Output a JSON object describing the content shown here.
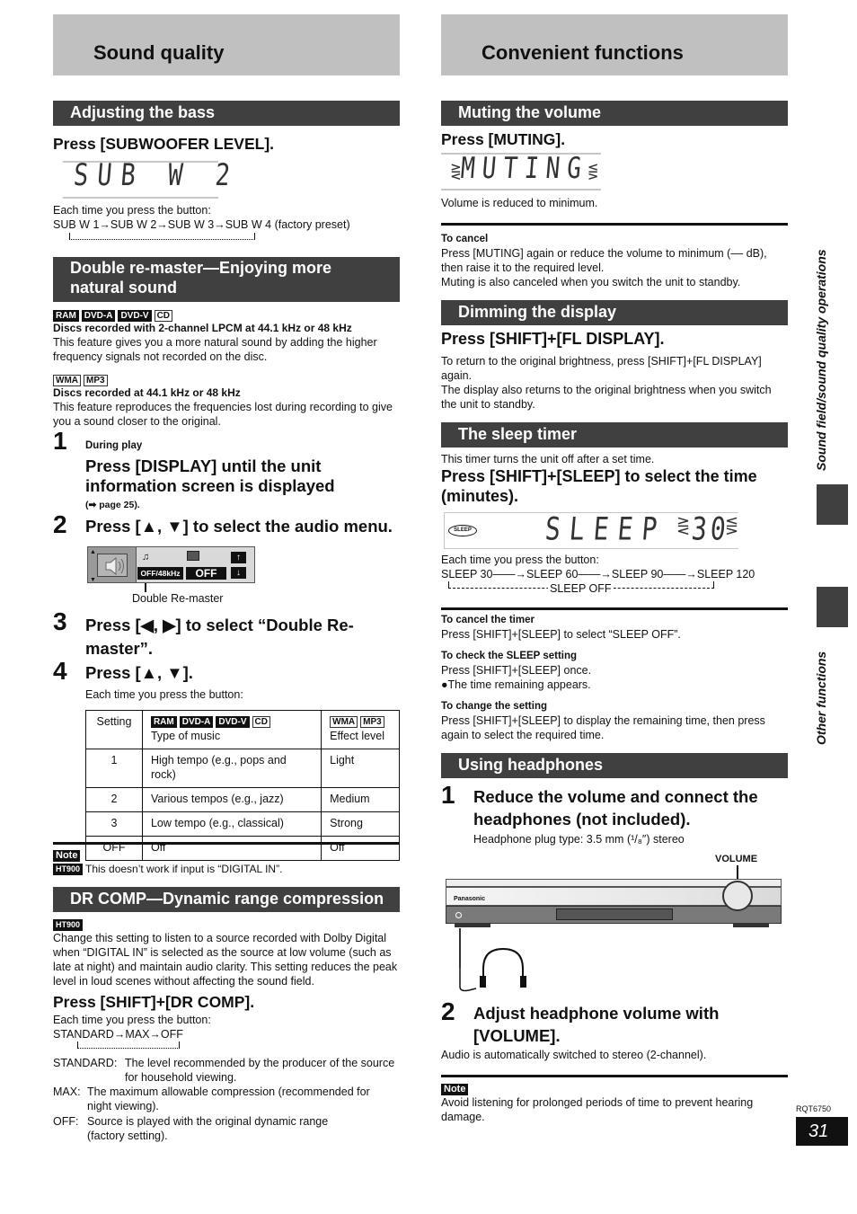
{
  "page": {
    "left_title": "Sound quality",
    "right_title": "Convenient functions",
    "side_labels": [
      "Sound field/sound quality operations",
      "Other functions"
    ],
    "model_code": "RQT6750",
    "page_number": "31"
  },
  "bass": {
    "section": "Adjusting the bass",
    "press": "Press [SUBWOOFER LEVEL].",
    "lcd": "SUB W 2",
    "each_time": "Each time you press the button:",
    "sequence": "SUB W 1→SUB W 2→SUB W 3→SUB W 4 (factory preset)"
  },
  "remaster": {
    "section_line1": "Double re-master—Enjoying more",
    "section_line2": "natural sound",
    "badges_a": [
      "RAM",
      "DVD-A",
      "DVD-V",
      "CD"
    ],
    "heading_a": "Discs recorded with 2-channel LPCM at 44.1 kHz or 48 kHz",
    "body_a": "This feature gives you a more natural sound by adding the higher frequency signals not recorded on the disc.",
    "badges_b": [
      "WMA",
      "MP3"
    ],
    "heading_b": "Discs recorded at 44.1 kHz or 48 kHz",
    "body_b": "This feature reproduces the frequencies lost during recording to give you a sound closer to the original.",
    "steps": [
      {
        "num": "1",
        "pre": "During play",
        "head": "Press [DISPLAY] until the unit information screen is displayed",
        "ref": "(➡ page 25)."
      },
      {
        "num": "2",
        "head": "Press [▲, ▼] to select the audio menu."
      },
      {
        "num": "3",
        "head": "Press [◀, ▶] to select “Double Re-master”."
      },
      {
        "num": "4",
        "head": "Press [▲, ▼].",
        "sub": "Each time you press the button:"
      }
    ],
    "osd": {
      "value1": "OFF/48kHz",
      "value2": "OFF",
      "caption": "Double Re-master"
    },
    "table": {
      "headers": [
        "Setting",
        "Type of music",
        "Effect level"
      ],
      "header_badges_mid": [
        "RAM",
        "DVD-A",
        "DVD-V",
        "CD"
      ],
      "header_badges_right": [
        "WMA",
        "MP3"
      ],
      "rows": [
        [
          "1",
          "High tempo (e.g., pops and rock)",
          "Light"
        ],
        [
          "2",
          "Various tempos (e.g., jazz)",
          "Medium"
        ],
        [
          "3",
          "Low tempo (e.g., classical)",
          "Strong"
        ],
        [
          "OFF",
          "Off",
          "Off"
        ]
      ]
    },
    "note_label": "Note",
    "note_badge": "HT900",
    "note_text": "This doesn’t work if input is “DIGITAL IN”."
  },
  "drcomp": {
    "section": "DR COMP—Dynamic range compression",
    "badge": "HT900",
    "body": "Change this setting to listen to a source recorded with Dolby Digital when “DIGITAL IN” is selected as the source at low volume (such as late at night) and maintain audio clarity. This setting reduces the peak level in loud scenes without affecting the sound field.",
    "press": "Press [SHIFT]+[DR COMP].",
    "each_time": "Each time you press the button:",
    "sequence": "STANDARD→MAX→OFF",
    "defs": [
      {
        "term": "STANDARD:",
        "desc1": "The level recommended by the producer of the source",
        "desc2": "for household viewing."
      },
      {
        "term": "MAX:",
        "desc1": "The maximum allowable compression (recommended for",
        "desc2": "night viewing)."
      },
      {
        "term": "OFF:",
        "desc1": "Source is played with the original dynamic range",
        "desc2": "(factory setting)."
      }
    ]
  },
  "muting": {
    "section": "Muting the volume",
    "press": "Press [MUTING].",
    "lcd": "MUTING",
    "body": "Volume is reduced to minimum.",
    "cancel_head": "To cancel",
    "cancel_1": "Press [MUTING] again or reduce the volume to minimum (–– dB),",
    "cancel_2": "then raise it to the required level.",
    "cancel_3": "Muting is also canceled when you switch the unit to standby."
  },
  "dimming": {
    "section": "Dimming the display",
    "press": "Press [SHIFT]+[FL DISPLAY].",
    "body_1": "To return to the original brightness, press [SHIFT]+[FL DISPLAY]",
    "body_2": "again.",
    "body_3": "The display also returns to the original brightness when you switch",
    "body_4": "the unit to standby."
  },
  "sleep": {
    "section": "The sleep timer",
    "intro": "This timer turns the unit off after a set time.",
    "press_1": "Press [SHIFT]+[SLEEP] to select the time",
    "press_2": "(minutes).",
    "lcd_tag": "SLEEP",
    "lcd": "SLEEP",
    "lcd_value": "30",
    "each_time": "Each time you press the button:",
    "sequence": "SLEEP 30——→SLEEP 60——→SLEEP 90——→SLEEP 120",
    "loop_label": "SLEEP OFF",
    "cancel_head": "To cancel the timer",
    "cancel_body": "Press [SHIFT]+[SLEEP] to select “SLEEP OFF”.",
    "check_head": "To check the SLEEP setting",
    "check_body": "Press [SHIFT]+[SLEEP] once.",
    "check_bullet": "●The time remaining appears.",
    "change_head": "To change the setting",
    "change_body_1": "Press [SHIFT]+[SLEEP] to display the remaining time, then press",
    "change_body_2": "again to select the required time."
  },
  "headphones": {
    "section": "Using headphones",
    "step1_num": "1",
    "step1_line1": "Reduce the volume and connect the",
    "step1_line2": "headphones (not included).",
    "plug_type": "Headphone plug type:  3.5 mm (¹/₈″) stereo",
    "volume_label": "VOLUME",
    "brand": "Panasonic",
    "step2_num": "2",
    "step2_line1": "Adjust headphone volume with",
    "step2_line2": "[VOLUME].",
    "step2_body": "Audio is automatically switched to stereo (2-channel).",
    "note_label": "Note",
    "note_1": "Avoid listening for prolonged periods of time to prevent hearing",
    "note_2": "damage."
  }
}
